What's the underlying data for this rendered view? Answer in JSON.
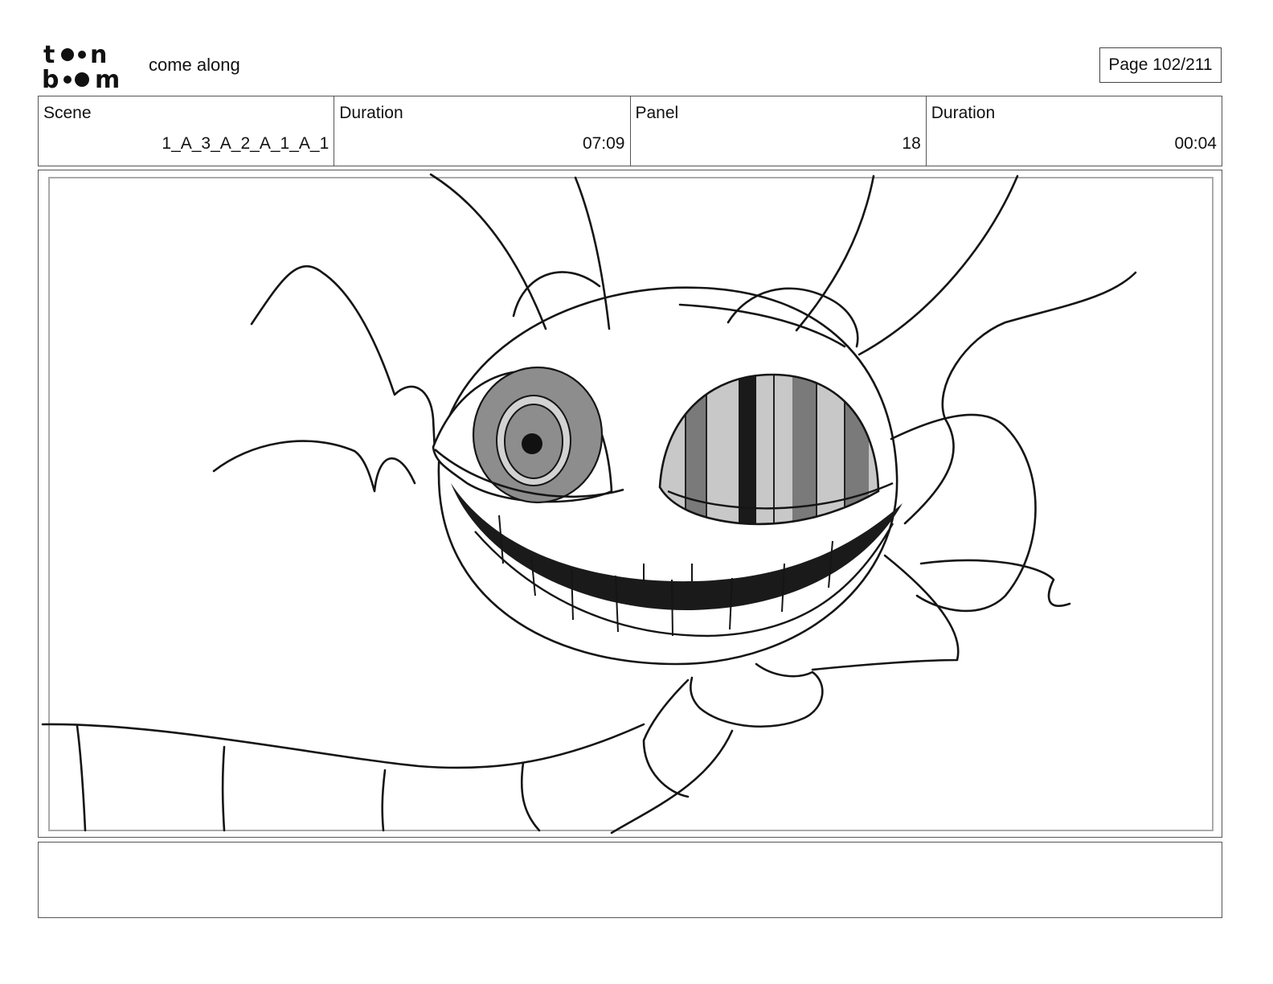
{
  "header": {
    "logo_text": "toonboom",
    "project_title": "come along",
    "page_label": "Page 102/211"
  },
  "info": [
    {
      "label": "Scene",
      "value": "1_A_3_A_2_A_1_A_1"
    },
    {
      "label": "Duration",
      "value": "07:09"
    },
    {
      "label": "Panel",
      "value": "18"
    },
    {
      "label": "Duration",
      "value": "00:04"
    }
  ],
  "panel": {
    "drawing": "grinning-creature-sketch"
  },
  "notes": {
    "text": ""
  }
}
